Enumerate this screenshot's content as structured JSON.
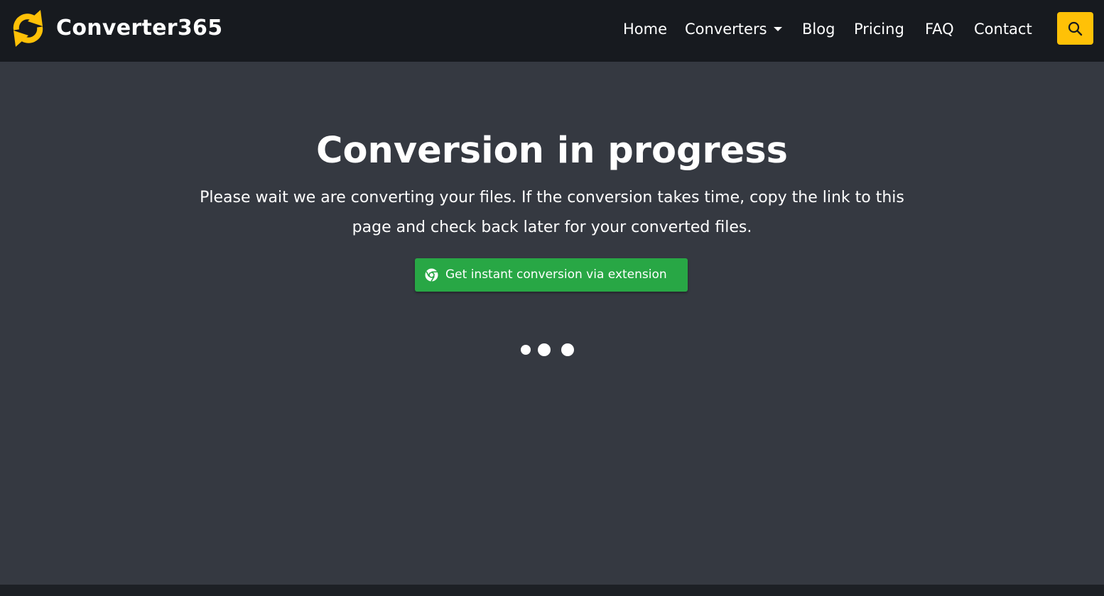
{
  "brand": {
    "name": "Converter365",
    "logo_icon": "refresh-arrows-icon",
    "logo_color": "#ffc107"
  },
  "nav": {
    "home": "Home",
    "converters": "Converters",
    "blog": "Blog",
    "pricing": "Pricing",
    "faq": "FAQ",
    "contact": "Contact",
    "search_icon": "search-icon",
    "search_color": "#ffc107"
  },
  "main": {
    "title": "Conversion in progress",
    "subtitle": "Please wait we are converting your files. If the conversion takes time, copy the link to this page and check back later for your converted files.",
    "extension_button": {
      "label": "Get instant conversion via extension",
      "icon": "chrome-icon",
      "color": "#28a745"
    },
    "loading_indicator": "three-dot-loader"
  },
  "colors": {
    "navbar_bg": "#171a1f",
    "page_bg": "#353941",
    "text": "#ffffff"
  }
}
